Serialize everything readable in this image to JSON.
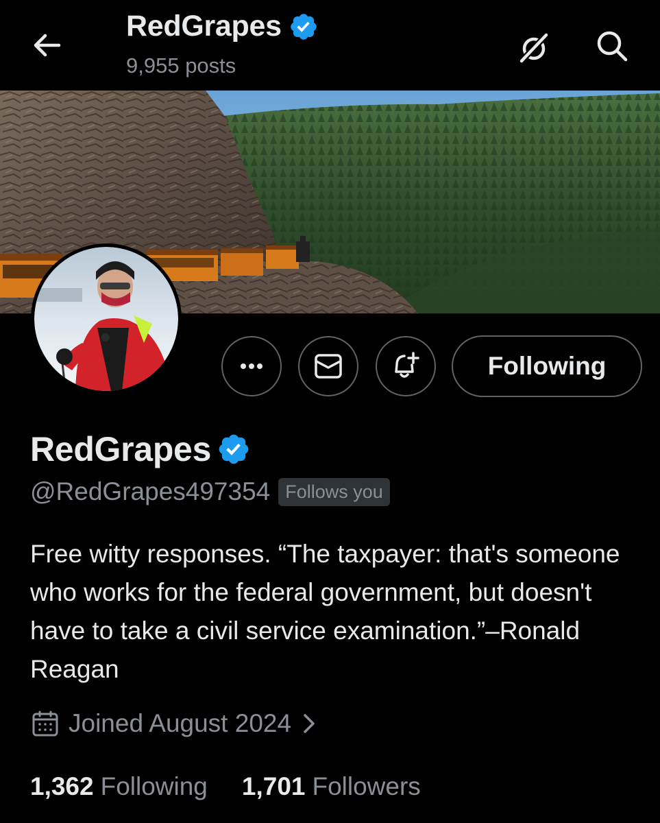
{
  "header": {
    "title": "RedGrapes",
    "posts_count": "9,955 posts",
    "back_icon": "arrow-left-icon",
    "grok_icon": "grok-icon",
    "search_icon": "search-icon"
  },
  "profile": {
    "display_name": "RedGrapes",
    "handle": "@RedGrapes497354",
    "follows_you": "Follows you",
    "bio": "Free witty responses. “The taxpayer: that's someone who works for the federal government, but doesn't have to take a civil service examination.”–Ronald Reagan",
    "joined": "Joined August 2024",
    "verified_color": "#1d9bf0"
  },
  "actions": {
    "more_icon": "more-icon",
    "message_icon": "mail-icon",
    "notify_icon": "bell-plus-icon",
    "following_label": "Following"
  },
  "stats": {
    "following_count": "1,362",
    "following_label": "Following",
    "followers_count": "1,701",
    "followers_label": "Followers"
  },
  "colors": {
    "background": "#000000",
    "text_primary": "#e7e9ea",
    "text_secondary": "#8b9096",
    "border": "#5f6468",
    "badge_bg": "#2f3336"
  }
}
